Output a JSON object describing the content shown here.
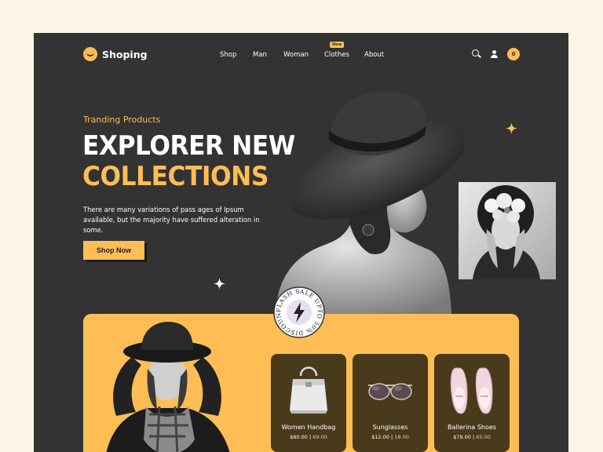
{
  "brand": {
    "name": "Shoping"
  },
  "nav": {
    "items": [
      "Shop",
      "Man",
      "Woman",
      "Clothes",
      "About"
    ],
    "new_badge": "New"
  },
  "header": {
    "cart_count": "0"
  },
  "hero": {
    "eyebrow": "Tranding Products",
    "title_line1": "EXPLORER NEW",
    "title_line2": "COLLECTIONS",
    "description": "There are many variations of pass ages of Ipsum available, but the majority have suffered alteration in some.",
    "cta": "Shop Now"
  },
  "seal": {
    "text": "FLASH SALE UPTO 50% DISCOUNT"
  },
  "products": [
    {
      "name": "Women Handbag",
      "price": "$60.00",
      "old_price": "69.00",
      "icon": "handbag-icon"
    },
    {
      "name": "Sunglasses",
      "price": "$12.00",
      "old_price": "18.00",
      "icon": "sunglasses-icon"
    },
    {
      "name": "Ballerina Shoes",
      "price": "$79.00",
      "old_price": "65.00",
      "icon": "shoes-icon"
    }
  ],
  "colors": {
    "background": "#fdf6e6",
    "frame": "#333333",
    "accent": "#ffbe55",
    "card": "#4a3a1c"
  }
}
